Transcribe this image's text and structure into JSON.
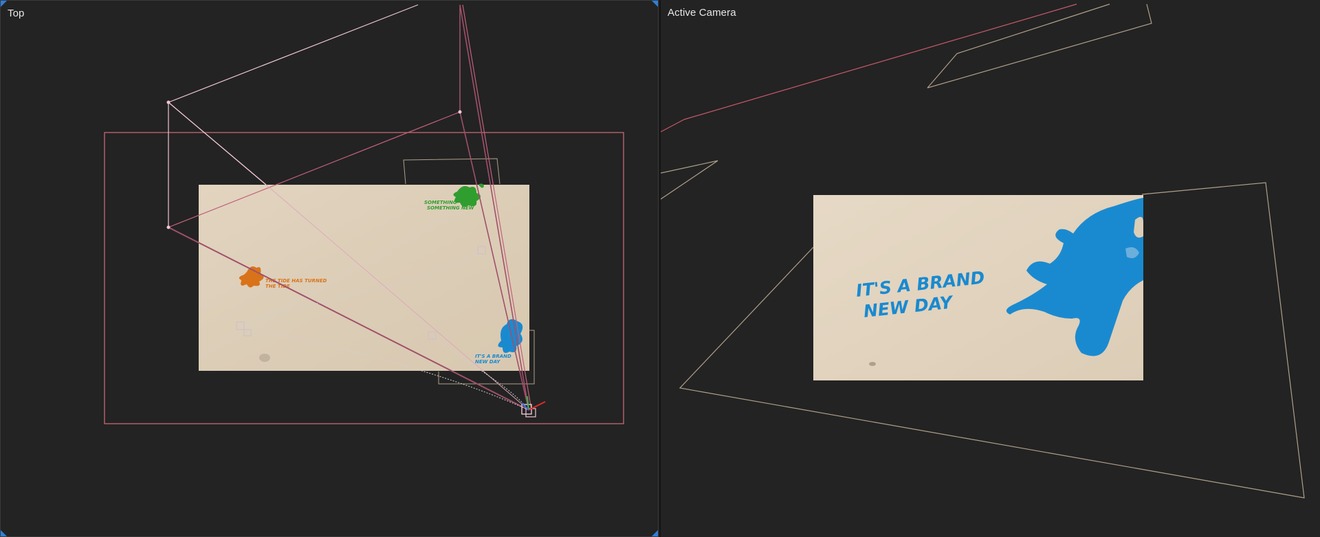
{
  "viewports": {
    "top": {
      "label": "Top"
    },
    "active_camera": {
      "label": "Active Camera"
    }
  },
  "layers": {
    "orange": {
      "text_line1": "THE TIDE HAS TURNED",
      "text_line2": "THE TIDE",
      "color": "#d9731a"
    },
    "green": {
      "text_line1": "SOMETHING",
      "text_line2": "SOMETHING NEW",
      "color": "#2f9e2f"
    },
    "blue": {
      "text_line1": "IT'S A BRAND",
      "text_line2": "NEW DAY",
      "color": "#1a8ad0"
    }
  },
  "colors": {
    "accent": "#2f7fd8",
    "viewport_bg": "#232323",
    "paper": "#e4d6c2",
    "comp_frame": "#d36d7a",
    "camera_wire": "#f0c6d3",
    "path_wire": "#b0a08a"
  }
}
